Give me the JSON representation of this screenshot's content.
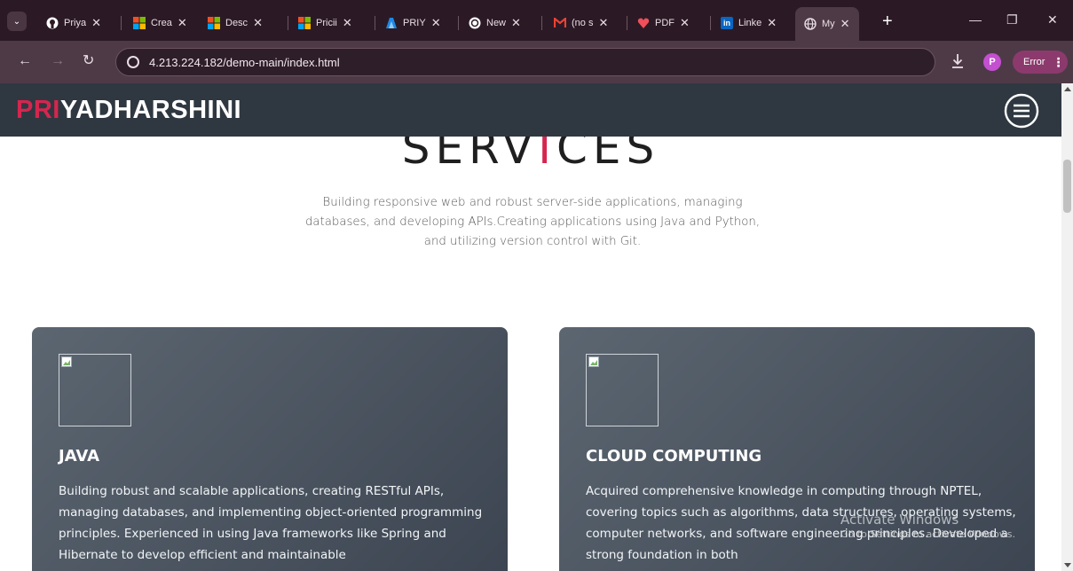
{
  "browser": {
    "tabs": [
      {
        "label": "Priya",
        "icon": "github-icon"
      },
      {
        "label": "Crea",
        "icon": "microsoft-icon"
      },
      {
        "label": "Desc",
        "icon": "microsoft-icon"
      },
      {
        "label": "Pricii",
        "icon": "microsoft-icon"
      },
      {
        "label": "PRIY",
        "icon": "azure-icon"
      },
      {
        "label": "New",
        "icon": "chatgpt-icon"
      },
      {
        "label": "(no s",
        "icon": "gmail-icon"
      },
      {
        "label": "PDF",
        "icon": "pdf-icon"
      },
      {
        "label": "Linke",
        "icon": "linkedin-icon"
      },
      {
        "label": "My",
        "icon": "globe-icon",
        "active": true
      }
    ],
    "url": "4.213.224.182/demo-main/index.html",
    "profile_initial": "P",
    "error_label": "Error"
  },
  "site": {
    "logo_accent": "PRI",
    "logo_rest": "YADHARSHINI",
    "accent_color": "#d5264f"
  },
  "services": {
    "title_part1": "SERV",
    "title_accent": "I",
    "title_part2": "CES",
    "intro": "Building responsive web and robust server-side applications, managing databases, and developing APIs.Creating applications using Java and Python, and utilizing version control with Git.",
    "cards": [
      {
        "title": "JAVA",
        "description": "Building robust and scalable applications, creating RESTful APIs, managing databases, and implementing object-oriented programming principles. Experienced in using Java frameworks like Spring and Hibernate to develop efficient and maintainable"
      },
      {
        "title": "CLOUD COMPUTING",
        "description": "Acquired comprehensive knowledge in computing through NPTEL, covering topics such as algorithms, data structures, operating systems, computer networks, and software engineering principles. Developed a strong foundation in both"
      }
    ]
  },
  "watermark": {
    "line1": "Activate Windows",
    "line2": "Go to Settings to activate Windows."
  }
}
